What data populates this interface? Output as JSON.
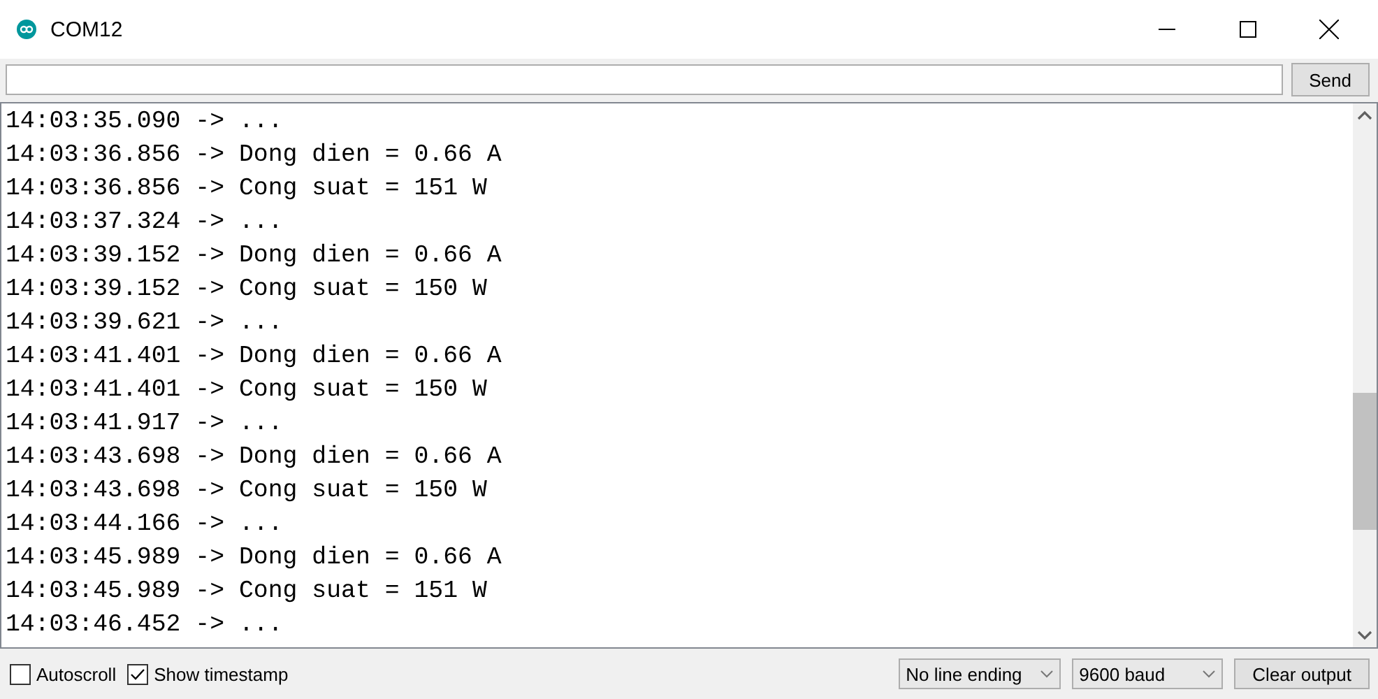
{
  "window": {
    "title": "COM12"
  },
  "send_button": "Send",
  "output_lines": [
    "14:03:35.090 -> ...",
    "14:03:36.856 -> Dong dien = 0.66 A",
    "14:03:36.856 -> Cong suat = 151 W",
    "14:03:37.324 -> ...",
    "14:03:39.152 -> Dong dien = 0.66 A",
    "14:03:39.152 -> Cong suat = 150 W",
    "14:03:39.621 -> ...",
    "14:03:41.401 -> Dong dien = 0.66 A",
    "14:03:41.401 -> Cong suat = 150 W",
    "14:03:41.917 -> ...",
    "14:03:43.698 -> Dong dien = 0.66 A",
    "14:03:43.698 -> Cong suat = 150 W",
    "14:03:44.166 -> ...",
    "14:03:45.989 -> Dong dien = 0.66 A",
    "14:03:45.989 -> Cong suat = 151 W",
    "14:03:46.452 -> ..."
  ],
  "options": [
    {
      "label": "Autoscroll",
      "checked": false
    },
    {
      "label": "Show timestamp",
      "checked": true
    }
  ],
  "line_ending": "No line ending",
  "baud": "9600 baud",
  "clear_button": "Clear output"
}
